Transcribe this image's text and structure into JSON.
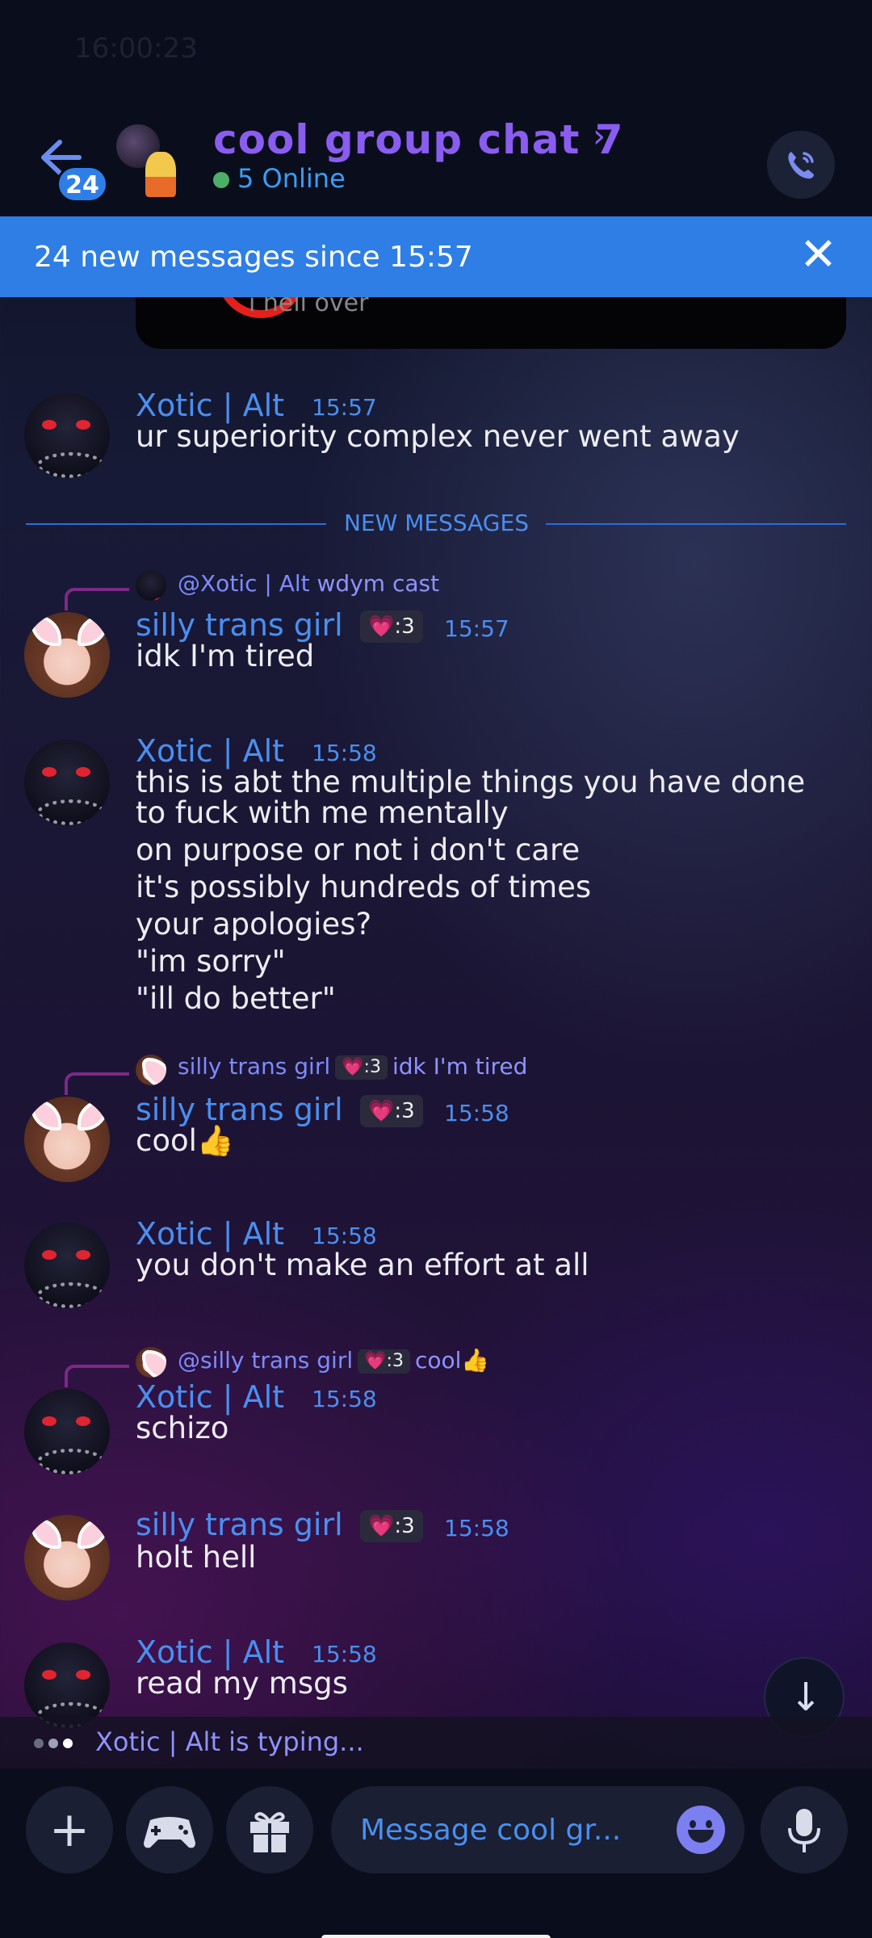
{
  "status_bar": {
    "time": "16:00:23"
  },
  "header": {
    "back_badge": "24",
    "title": "cool group chat 7",
    "title_arrow": "›",
    "online": "5 Online"
  },
  "banner": {
    "text": "24 new messages since 15:57",
    "close": "✕"
  },
  "embed": {
    "text": "i hell over"
  },
  "divider": {
    "label": "NEW MESSAGES"
  },
  "messages": [
    {
      "author": "Xotic | Alt",
      "time": "15:57",
      "lines": [
        "ur superiority complex never went away"
      ]
    },
    {
      "reply_prefix": "@Xotic | Alt",
      "reply_text": "wdym cast",
      "author": "silly trans girl",
      "tag": ":3",
      "time": "15:57",
      "lines": [
        "idk I'm tired"
      ]
    },
    {
      "author": "Xotic | Alt",
      "time": "15:58",
      "lines": [
        "this is abt the multiple things you have done",
        "to fuck with me mentally",
        "on purpose or not i don't care",
        "it's possibly hundreds of times",
        "your apologies?",
        "\"im sorry\"",
        "\"ill do better\""
      ]
    },
    {
      "reply_prefix": "silly trans girl",
      "reply_tag": ":3",
      "reply_text": "idk I'm tired",
      "author": "silly trans girl",
      "tag": ":3",
      "time": "15:58",
      "lines": [
        "cool👍"
      ]
    },
    {
      "author": "Xotic | Alt",
      "time": "15:58",
      "lines": [
        "you don't make an effort at all"
      ]
    },
    {
      "reply_prefix": "@silly trans girl",
      "reply_tag": ":3",
      "reply_text": "cool👍",
      "author": "Xotic | Alt",
      "time": "15:58",
      "lines": [
        "schizo"
      ]
    },
    {
      "author": "silly trans girl",
      "tag": ":3",
      "time": "15:58",
      "lines": [
        "holt hell"
      ]
    },
    {
      "author": "Xotic | Alt",
      "time": "15:58",
      "lines": [
        "read my msgs"
      ]
    }
  ],
  "typing": {
    "text": "Xotic | Alt is typing..."
  },
  "composer": {
    "placeholder": "Message cool gr..."
  },
  "colors": {
    "accent": "#2e7ee6",
    "username": "#4a8ff0",
    "title": "#8a5df0",
    "reply": "#8f93ff"
  },
  "icons": [
    "back-arrow-icon",
    "phone-call-icon",
    "close-icon",
    "plus-icon",
    "gamepad-icon",
    "gift-icon",
    "emoji-icon",
    "microphone-icon",
    "arrow-down-icon"
  ]
}
